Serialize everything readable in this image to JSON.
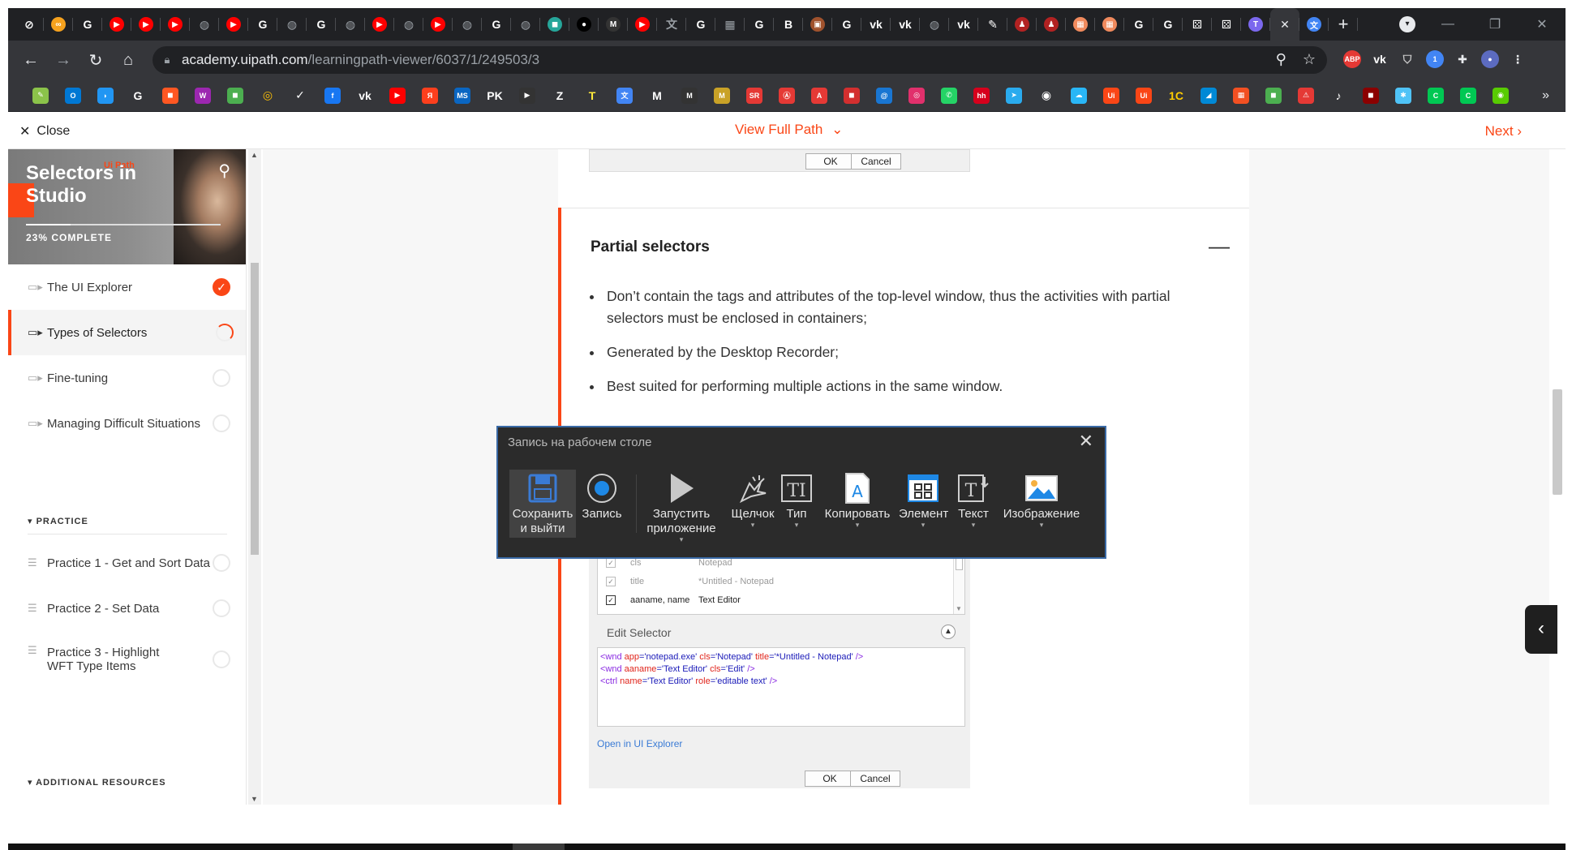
{
  "browser": {
    "tabs": [
      {
        "icon": "chain-icon",
        "color": "#ffffff",
        "glyph": "⊘"
      },
      {
        "icon": "infinity-icon",
        "color": "#f6a21e",
        "glyph": "∞"
      },
      {
        "icon": "google-icon",
        "color": "#ffffff",
        "glyph": "G"
      },
      {
        "icon": "youtube-icon",
        "color": "#ff0000",
        "glyph": "▶"
      },
      {
        "icon": "youtube-icon",
        "color": "#ff0000",
        "glyph": "▶"
      },
      {
        "icon": "youtube-icon",
        "color": "#ff0000",
        "glyph": "▶"
      },
      {
        "icon": "globe-icon",
        "color": "#9aa0a6",
        "glyph": "◍"
      },
      {
        "icon": "youtube-icon",
        "color": "#ff0000",
        "glyph": "▶"
      },
      {
        "icon": "google-icon",
        "color": "#ffffff",
        "glyph": "G"
      },
      {
        "icon": "globe-icon",
        "color": "#9aa0a6",
        "glyph": "◍"
      },
      {
        "icon": "google-icon",
        "color": "#ffffff",
        "glyph": "G"
      },
      {
        "icon": "globe-icon",
        "color": "#9aa0a6",
        "glyph": "◍"
      },
      {
        "icon": "youtube-icon",
        "color": "#ff0000",
        "glyph": "▶"
      },
      {
        "icon": "globe-icon",
        "color": "#9aa0a6",
        "glyph": "◍"
      },
      {
        "icon": "youtube-icon",
        "color": "#ff0000",
        "glyph": "▶"
      },
      {
        "icon": "globe-icon",
        "color": "#9aa0a6",
        "glyph": "◍"
      },
      {
        "icon": "google-icon",
        "color": "#ffffff",
        "glyph": "G"
      },
      {
        "icon": "globe-icon",
        "color": "#9aa0a6",
        "glyph": "◍"
      },
      {
        "icon": "teal-app-icon",
        "color": "#26a69a",
        "glyph": "◼"
      },
      {
        "icon": "black-circle-icon",
        "color": "#000000",
        "glyph": "●"
      },
      {
        "icon": "m-logo-icon",
        "color": "#333333",
        "glyph": "M"
      },
      {
        "icon": "youtube-icon",
        "color": "#ff0000",
        "glyph": "▶"
      },
      {
        "icon": "translate-icon",
        "color": "#9aa0a6",
        "glyph": "文"
      },
      {
        "icon": "google-icon",
        "color": "#ffffff",
        "glyph": "G"
      },
      {
        "icon": "table-icon",
        "color": "#9aa0a6",
        "glyph": "▦"
      },
      {
        "icon": "google-icon",
        "color": "#ffffff",
        "glyph": "G"
      },
      {
        "icon": "b-icon",
        "color": "#ffffff",
        "glyph": "B"
      },
      {
        "icon": "image-icon",
        "color": "#a0522d",
        "glyph": "▣"
      },
      {
        "icon": "google-icon",
        "color": "#ffffff",
        "glyph": "G"
      },
      {
        "icon": "vk-icon",
        "color": "#ffffff",
        "glyph": "vk"
      },
      {
        "icon": "vk-icon",
        "color": "#ffffff",
        "glyph": "vk"
      },
      {
        "icon": "globe-icon",
        "color": "#9aa0a6",
        "glyph": "◍"
      },
      {
        "icon": "vk-icon",
        "color": "#ffffff",
        "glyph": "vk"
      },
      {
        "icon": "pen-icon",
        "color": "#ffffff",
        "glyph": "✎"
      },
      {
        "icon": "person-icon",
        "color": "#b22222",
        "glyph": "♟"
      },
      {
        "icon": "person-icon",
        "color": "#b22222",
        "glyph": "♟"
      },
      {
        "icon": "grid-orange-icon",
        "color": "#f08a5d",
        "glyph": "▦"
      },
      {
        "icon": "grid-orange-icon",
        "color": "#f08a5d",
        "glyph": "▦"
      },
      {
        "icon": "google-icon",
        "color": "#ffffff",
        "glyph": "G"
      },
      {
        "icon": "google-icon",
        "color": "#ffffff",
        "glyph": "G"
      },
      {
        "icon": "dice-icon",
        "color": "#ffffff",
        "glyph": "⚄"
      },
      {
        "icon": "dice-icon",
        "color": "#ffffff",
        "glyph": "⚄"
      },
      {
        "icon": "twitch-like-icon",
        "color": "#7b68ee",
        "glyph": "T"
      }
    ],
    "active_tab": {
      "icon": "close-icon",
      "glyph": "✕"
    },
    "after_tabs": [
      {
        "icon": "translate-icon",
        "color": "#4285f4",
        "glyph": "文"
      }
    ],
    "new_tab": "+",
    "window_controls": {
      "minimize": "—",
      "restore": "❐",
      "close": "✕"
    },
    "url_host": "academy.uipath.com",
    "url_path": "/learningpath-viewer/6037/1/249503/3",
    "extensions": [
      {
        "icon": "adblock-icon",
        "color": "#e53935",
        "glyph": "ABP"
      },
      {
        "icon": "vk-icon",
        "color": "#ffffff",
        "glyph": "vk"
      },
      {
        "icon": "shield-icon",
        "color": "#cccccc",
        "glyph": "⛉"
      },
      {
        "icon": "ext-badge-icon",
        "color": "#4285f4",
        "glyph": "1"
      },
      {
        "icon": "puzzle-icon",
        "color": "#e8eaed",
        "glyph": "✚"
      },
      {
        "icon": "avatar-icon",
        "color": "#5c6bc0",
        "glyph": "●"
      },
      {
        "icon": "menu-dots-icon",
        "color": "#e8eaed",
        "glyph": "⋮"
      }
    ],
    "bookmarks": [
      {
        "icon": "brush-icon",
        "color": "#8bc34a",
        "glyph": "✎"
      },
      {
        "icon": "outlook-icon",
        "color": "#0078d4",
        "glyph": "O"
      },
      {
        "icon": "drop-icon",
        "color": "#2196f3",
        "glyph": "◗"
      },
      {
        "icon": "google-icon",
        "color": "#ffffff",
        "glyph": "G"
      },
      {
        "icon": "bag-icon",
        "color": "#ff5722",
        "glyph": "◼"
      },
      {
        "icon": "w-icon",
        "color": "#9c27b0",
        "glyph": "W"
      },
      {
        "icon": "green-icon",
        "color": "#4caf50",
        "glyph": "◼"
      },
      {
        "icon": "target-icon",
        "color": "#ffc107",
        "glyph": "◎"
      },
      {
        "icon": "check-circle-icon",
        "color": "#ffffff",
        "glyph": "✓"
      },
      {
        "icon": "facebook-icon",
        "color": "#1877f2",
        "glyph": "f"
      },
      {
        "icon": "vk-icon",
        "color": "#ffffff",
        "glyph": "vk"
      },
      {
        "icon": "youtube-icon",
        "color": "#ff0000",
        "glyph": "▶"
      },
      {
        "icon": "yandex-icon",
        "color": "#fc3f1d",
        "glyph": "Я"
      },
      {
        "icon": "ms-icon",
        "color": "#0a66c2",
        "glyph": "MS"
      },
      {
        "icon": "pk-icon",
        "color": "#ffffff",
        "glyph": "PK"
      },
      {
        "icon": "video-icon",
        "color": "#333333",
        "glyph": "▶"
      },
      {
        "icon": "z-icon",
        "color": "#ffffff",
        "glyph": "Z"
      },
      {
        "icon": "t-icon",
        "color": "#ffeb3b",
        "glyph": "T"
      },
      {
        "icon": "translate-icon",
        "color": "#4285f4",
        "glyph": "文"
      },
      {
        "icon": "m-icon",
        "color": "#ffffff",
        "glyph": "M"
      },
      {
        "icon": "m-logo-icon",
        "color": "#333333",
        "glyph": "M"
      },
      {
        "icon": "m-gold-icon",
        "color": "#c9a227",
        "glyph": "M"
      },
      {
        "icon": "sr-icon",
        "color": "#e53935",
        "glyph": "SR"
      },
      {
        "icon": "anarchy-icon",
        "color": "#e53935",
        "glyph": "Ⓐ"
      },
      {
        "icon": "a-icon",
        "color": "#e53935",
        "glyph": "A"
      },
      {
        "icon": "red-square-icon",
        "color": "#d32f2f",
        "glyph": "◼"
      },
      {
        "icon": "mail-icon",
        "color": "#1976d2",
        "glyph": "@"
      },
      {
        "icon": "instagram-icon",
        "color": "#e1306c",
        "glyph": "◎"
      },
      {
        "icon": "whatsapp-icon",
        "color": "#25d366",
        "glyph": "✆"
      },
      {
        "icon": "hh-icon",
        "color": "#d6001c",
        "glyph": "hh"
      },
      {
        "icon": "telegram-icon",
        "color": "#2aabee",
        "glyph": "➤"
      },
      {
        "icon": "github-icon",
        "color": "#ffffff",
        "glyph": "◉"
      },
      {
        "icon": "cloud-icon",
        "color": "#29b6f6",
        "glyph": "☁"
      },
      {
        "icon": "uipath-icon",
        "color": "#fa4616",
        "glyph": "Ui"
      },
      {
        "icon": "uipath-icon",
        "color": "#fa4616",
        "glyph": "Ui"
      },
      {
        "icon": "1c-icon",
        "color": "#ffcc00",
        "glyph": "1C"
      },
      {
        "icon": "azure-icon",
        "color": "#0089d6",
        "glyph": "◢"
      },
      {
        "icon": "microsoft-icon",
        "color": "#f25022",
        "glyph": "▦"
      },
      {
        "icon": "green-square-icon",
        "color": "#4caf50",
        "glyph": "◼"
      },
      {
        "icon": "warning-icon",
        "color": "#e53935",
        "glyph": "⚠"
      },
      {
        "icon": "tiktok-icon",
        "color": "#ffffff",
        "glyph": "♪"
      },
      {
        "icon": "dark-red-icon",
        "color": "#8b0000",
        "glyph": "◼"
      },
      {
        "icon": "gear-blue-icon",
        "color": "#4fc3f7",
        "glyph": "✱"
      },
      {
        "icon": "green-c-icon",
        "color": "#00c853",
        "glyph": "C"
      },
      {
        "icon": "green-c-icon",
        "color": "#00c853",
        "glyph": "C"
      },
      {
        "icon": "duo-icon",
        "color": "#58cc02",
        "glyph": "◉"
      }
    ],
    "bookmarks_more": "»"
  },
  "page": {
    "close_label": "Close",
    "view_path_label": "View Full Path",
    "next_label": "Next"
  },
  "sidebar": {
    "title": "Selectors in Studio",
    "logo_text": "Ui Path",
    "progress_text": "23% COMPLETE",
    "progress_fraction": 0.23,
    "lessons": [
      {
        "label": "The UI Explorer",
        "status": "done"
      },
      {
        "label": "Types of Selectors",
        "status": "in-progress",
        "active": true
      },
      {
        "label": "Fine-tuning",
        "status": "none"
      },
      {
        "label": "Managing Difficult Situations",
        "status": "none"
      }
    ],
    "practice_header": "PRACTICE",
    "practice": [
      {
        "label": "Practice 1 - Get and Sort Data"
      },
      {
        "label": "Practice 2 - Set Data"
      },
      {
        "label": "Practice 3 - Highlight WFT Type Items"
      }
    ],
    "resources_header": "ADDITIONAL RESOURCES"
  },
  "content": {
    "top_ok": "OK",
    "top_cancel": "Cancel",
    "section_title": "Partial selectors",
    "collapse_symbol": "—",
    "bullets": [
      "Don’t contain the tags and attributes of the top-level window, thus the activities with partial selectors must be enclosed in containers;",
      "Generated by the Desktop Recorder;",
      "Best suited for performing multiple actions in the same window."
    ],
    "attributes": [
      {
        "key": "cls",
        "value": "Notepad",
        "checked": true,
        "muted": true
      },
      {
        "key": "title",
        "value": "*Untitled - Notepad",
        "checked": true,
        "muted": true
      },
      {
        "key": "aaname, name",
        "value": "Text Editor",
        "checked": true,
        "muted": false
      }
    ],
    "edit_selector_label": "Edit Selector",
    "selector_lines": [
      [
        {
          "t": "<wnd ",
          "c": "tg"
        },
        {
          "t": "app",
          "c": "an"
        },
        {
          "t": "='notepad.exe' ",
          "c": "av"
        },
        {
          "t": "cls",
          "c": "an"
        },
        {
          "t": "='Notepad' ",
          "c": "av"
        },
        {
          "t": "title",
          "c": "an"
        },
        {
          "t": "='*Untitled - Notepad' ",
          "c": "av"
        },
        {
          "t": "/>",
          "c": "tg"
        }
      ],
      [
        {
          "t": "<wnd ",
          "c": "tg"
        },
        {
          "t": "aaname",
          "c": "an"
        },
        {
          "t": "='Text Editor' ",
          "c": "av"
        },
        {
          "t": "cls",
          "c": "an"
        },
        {
          "t": "='Edit' ",
          "c": "av"
        },
        {
          "t": "/>",
          "c": "tg"
        }
      ],
      [
        {
          "t": "<ctrl ",
          "c": "tg"
        },
        {
          "t": "name",
          "c": "an"
        },
        {
          "t": "='Text Editor' ",
          "c": "av"
        },
        {
          "t": "role",
          "c": "an"
        },
        {
          "t": "='editable text' ",
          "c": "av"
        },
        {
          "t": "/>",
          "c": "tg"
        }
      ]
    ],
    "open_ui_explorer": "Open in UI Explorer",
    "bottom_ok": "OK",
    "bottom_cancel": "Cancel"
  },
  "recorder": {
    "title": "Запись на рабочем столе",
    "buttons": [
      {
        "name": "save-exit",
        "label": "Сохранить и выйти"
      },
      {
        "name": "record",
        "label": "Запись"
      },
      {
        "name": "launch-app",
        "label": "Запустить приложение"
      },
      {
        "name": "click",
        "label": "Щелчок"
      },
      {
        "name": "type",
        "label": "Тип"
      },
      {
        "name": "copy",
        "label": "Копировать"
      },
      {
        "name": "element",
        "label": "Элемент"
      },
      {
        "name": "text",
        "label": "Текст"
      },
      {
        "name": "image",
        "label": "Изображение"
      }
    ]
  },
  "colors": {
    "brand": "#fa4616",
    "browser_dark": "#202124",
    "toolbar": "#35363a",
    "recorder_bg": "#2b2b2b"
  }
}
